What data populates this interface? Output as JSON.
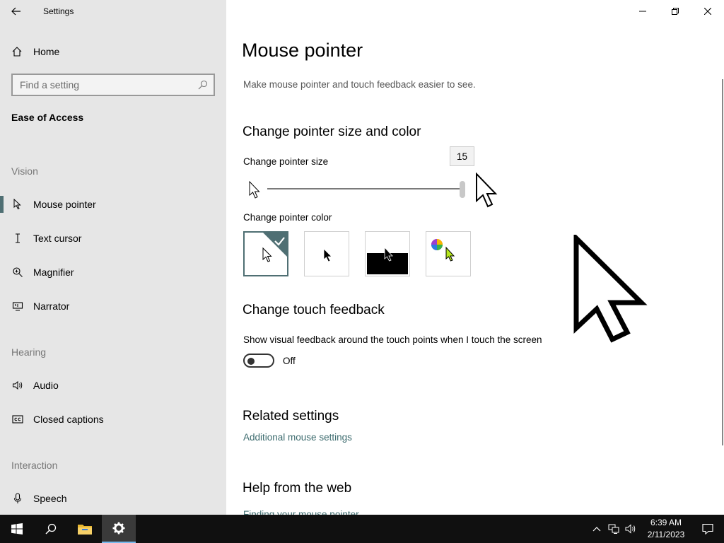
{
  "window": {
    "title": "Settings"
  },
  "sidebar": {
    "home_label": "Home",
    "search_placeholder": "Find a setting",
    "section": "Ease of Access",
    "groups": {
      "vision": "Vision",
      "hearing": "Hearing",
      "interaction": "Interaction"
    },
    "items": [
      {
        "label": "Mouse pointer",
        "icon": "mouse-pointer-icon",
        "active": true
      },
      {
        "label": "Text cursor",
        "icon": "text-cursor-icon"
      },
      {
        "label": "Magnifier",
        "icon": "magnifier-icon"
      },
      {
        "label": "Narrator",
        "icon": "narrator-icon"
      },
      {
        "label": "Audio",
        "icon": "speaker-icon"
      },
      {
        "label": "Closed captions",
        "icon": "closed-captions-icon"
      },
      {
        "label": "Speech",
        "icon": "microphone-icon"
      }
    ]
  },
  "main": {
    "title": "Mouse pointer",
    "description": "Make mouse pointer and touch feedback easier to see.",
    "pointer_section": {
      "heading": "Change pointer size and color",
      "size_label": "Change pointer size",
      "size_value": "15",
      "size_fraction": 0.98,
      "color_label": "Change pointer color",
      "color_options": [
        "white",
        "black",
        "inverted",
        "custom"
      ],
      "selected_color": "white"
    },
    "touch_section": {
      "heading": "Change touch feedback",
      "toggle_label": "Show visual feedback around the touch points when I touch the screen",
      "toggle_state": "Off"
    },
    "related": {
      "heading": "Related settings",
      "link": "Additional mouse settings"
    },
    "help": {
      "heading": "Help from the web",
      "link": "Finding your mouse pointer"
    }
  },
  "taskbar": {
    "time": "6:39 AM",
    "date": "2/11/2023"
  },
  "colors": {
    "sidebar_bg": "#e6e6e6",
    "accent": "#4f6f73",
    "link": "#3c6b6e",
    "taskbar_bg": "#101010"
  }
}
